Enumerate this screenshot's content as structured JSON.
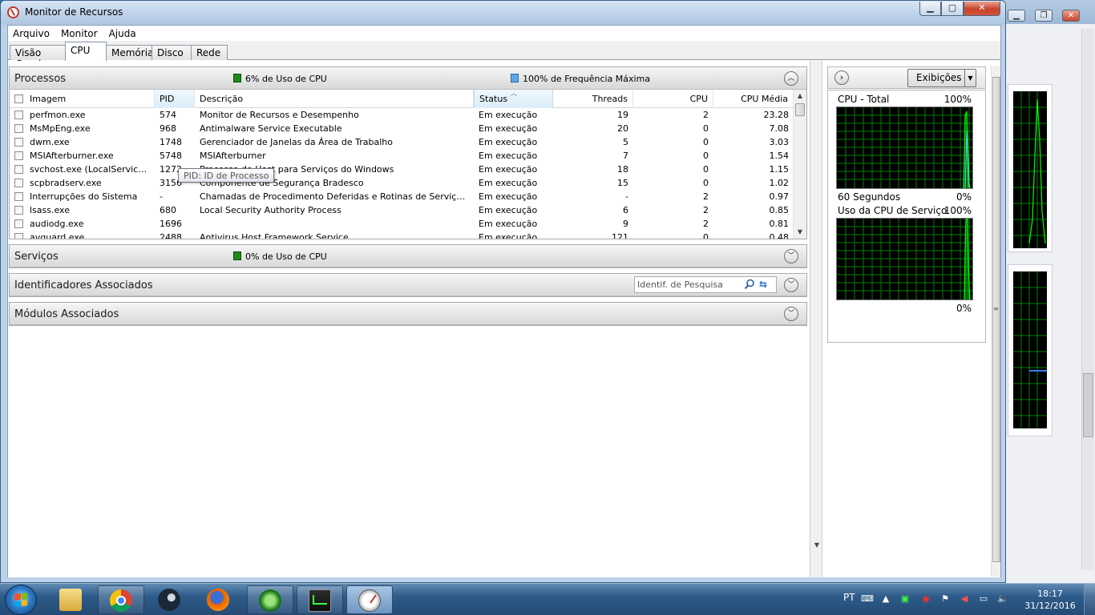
{
  "window": {
    "title": "Monitor de Recursos",
    "minimize": "▁",
    "maximize": "▢",
    "close": "✕"
  },
  "menu": [
    "Arquivo",
    "Monitor",
    "Ajuda"
  ],
  "tabs": [
    "Visão Geral",
    "CPU",
    "Memória",
    "Disco",
    "Rede"
  ],
  "active_tab": "CPU",
  "processes": {
    "title": "Processos",
    "cpu_usage": "6% de Uso de CPU",
    "max_freq": "100% de Frequência Máxima",
    "columns": [
      "Imagem",
      "PID",
      "Descrição",
      "Status",
      "Threads",
      "CPU",
      "CPU Média"
    ],
    "tooltip": "PID: ID de Processo",
    "rows": [
      {
        "image": "perfmon.exe",
        "pid": "574",
        "desc": "Monitor de Recursos e Desempenho",
        "status": "Em execução",
        "threads": "19",
        "cpu": "2",
        "avg": "23.28"
      },
      {
        "image": "MsMpEng.exe",
        "pid": "968",
        "desc": "Antimalware Service Executable",
        "status": "Em execução",
        "threads": "20",
        "cpu": "0",
        "avg": "7.08"
      },
      {
        "image": "dwm.exe",
        "pid": "1748",
        "desc": "Gerenciador de Janelas da Área de Trabalho",
        "status": "Em execução",
        "threads": "5",
        "cpu": "0",
        "avg": "3.03"
      },
      {
        "image": "MSIAfterburner.exe",
        "pid": "5748",
        "desc": "MSIAfterburner",
        "status": "Em execução",
        "threads": "7",
        "cpu": "0",
        "avg": "1.54"
      },
      {
        "image": "svchost.exe (LocalServiceNo...",
        "pid": "1272",
        "desc": "Processo de Host para Serviços do Windows",
        "status": "Em execução",
        "threads": "18",
        "cpu": "0",
        "avg": "1.15"
      },
      {
        "image": "scpbradserv.exe",
        "pid": "3156",
        "desc": "Componente de Segurança Bradesco",
        "status": "Em execução",
        "threads": "15",
        "cpu": "0",
        "avg": "1.02"
      },
      {
        "image": "Interrupções do Sistema",
        "pid": "-",
        "desc": "Chamadas de Procedimento Deferidas e Rotinas de Serviço Inte...",
        "status": "Em execução",
        "threads": "-",
        "cpu": "2",
        "avg": "0.97"
      },
      {
        "image": "lsass.exe",
        "pid": "680",
        "desc": "Local Security Authority Process",
        "status": "Em execução",
        "threads": "6",
        "cpu": "2",
        "avg": "0.85"
      },
      {
        "image": "audiodg.exe",
        "pid": "1696",
        "desc": "",
        "status": "Em execução",
        "threads": "9",
        "cpu": "2",
        "avg": "0.81"
      },
      {
        "image": "avguard.exe",
        "pid": "2488",
        "desc": "Antivirus Host Framework Service",
        "status": "Em execução",
        "threads": "121",
        "cpu": "0",
        "avg": "0.48"
      }
    ]
  },
  "services": {
    "title": "Serviços",
    "cpu_usage": "0% de Uso de CPU"
  },
  "handles": {
    "title": "Identificadores Associados",
    "search_placeholder": "Identif. de Pesquisa"
  },
  "modules": {
    "title": "Módulos Associados"
  },
  "right": {
    "views_label": "Exibições",
    "cpu_total_label": "CPU - Total",
    "cpu_total_max": "100%",
    "cpu_total_time": "60 Segundos",
    "cpu_total_min": "0%",
    "svc_label": "Uso da CPU de Serviço",
    "svc_max": "100%",
    "svc_min": "0%"
  },
  "taskbar": {
    "lang": "PT",
    "time": "18:17",
    "date": "31/12/2016"
  },
  "colors": {
    "graph_bg": "#000000",
    "graph_grid": "#008000",
    "graph_line": "#00ff00",
    "cpu_square": "#1b8a1b",
    "freq_square": "#5ba8e8"
  }
}
